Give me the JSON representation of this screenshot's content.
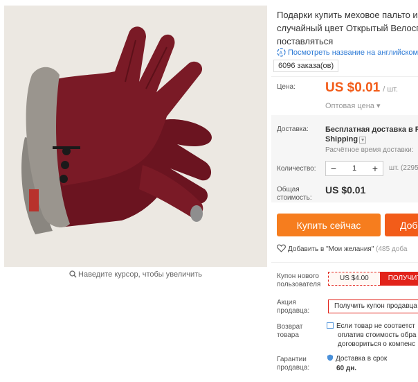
{
  "product": {
    "title_lines": [
      "Подарки купить меховое пальто и",
      "случайный цвет Открытый Велосп",
      "поставляться"
    ],
    "english_link": "Посмотреть название на английском",
    "orders": "6096 заказа(ов)"
  },
  "gallery": {
    "zoom_hint": "Наведите курсор, чтобы увеличить"
  },
  "price": {
    "label": "Цена:",
    "value": "US $0.01",
    "unit": "/ шт.",
    "wholesale": "Оптовая цена ▾"
  },
  "shipping": {
    "label": "Доставка:",
    "line1": "Бесплатная доставка в Ru",
    "line2": "Shipping",
    "estimate": "Расчётное время доставки:"
  },
  "quantity": {
    "label": "Количество:",
    "minus": "−",
    "value": "1",
    "plus": "+",
    "unit": "шт. (2295"
  },
  "total": {
    "label_lines": [
      "Общая",
      "стоимость:"
    ],
    "value": "US $0.01"
  },
  "actions": {
    "buy": "Купить сейчас",
    "cart": "Доб"
  },
  "wishlist": {
    "text": "Добавить в \"Мои желания\"",
    "count": "(485 доба"
  },
  "coupon": {
    "label_lines": [
      "Купон нового",
      "пользователя"
    ],
    "amount": "US $4.00",
    "get": "ПОЛУЧИТЬ"
  },
  "promo": {
    "label_lines": [
      "Акция",
      "продавца:"
    ],
    "button": "Получить купон продавца"
  },
  "returns": {
    "label_lines": [
      "Возврат",
      "товара"
    ],
    "lines": [
      "Если товар не соответст",
      "оплатив стоимость обра",
      "договориться о компенс"
    ]
  },
  "guarantee": {
    "label_lines": [
      "Гарантии",
      "продавца:"
    ],
    "line1": "Доставка в срок",
    "line2": "60 дн."
  },
  "colors": {
    "price": "#f25c19",
    "buy_button": "#f67d1e",
    "cart_button": "#f25c19",
    "coupon_red": "#e2231a",
    "link_blue": "#2e7bd6",
    "glove": "#7a1a26"
  }
}
